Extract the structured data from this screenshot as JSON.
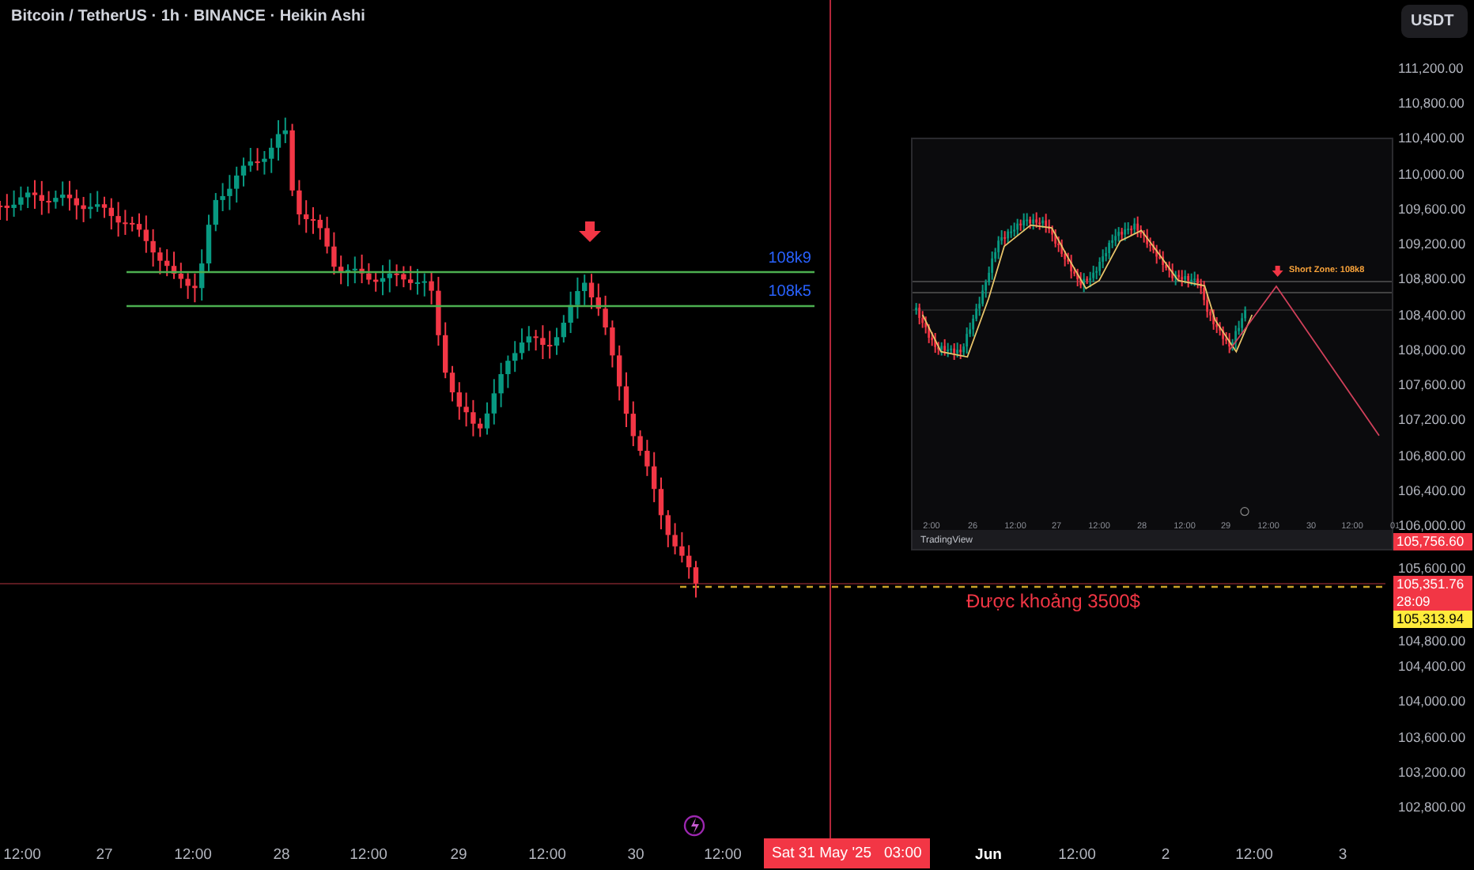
{
  "header": {
    "symbol_title": "Bitcoin / TetherUS · 1h · BINANCE · Heikin Ashi",
    "currency_button": "USDT"
  },
  "price_axis": {
    "ticks": [
      "111,200.00",
      "110,800.00",
      "110,400.00",
      "110,000.00",
      "109,600.00",
      "109,200.00",
      "108,800.00",
      "108,400.00",
      "108,000.00",
      "107,600.00",
      "107,200.00",
      "106,800.00",
      "106,400.00",
      "106,000.00",
      "105,600.00",
      "104,800.00",
      "104,400.00",
      "104,000.00",
      "103,600.00",
      "103,200.00",
      "102,800.00"
    ],
    "tags": [
      {
        "kind": "price",
        "text": "105,756.60",
        "color": "#f23645"
      },
      {
        "kind": "countdown",
        "text": "105,351.76",
        "countdown": "28:09",
        "color": "#f23645"
      },
      {
        "kind": "price",
        "text": "105,313.94",
        "color": "#ffeb3b"
      }
    ]
  },
  "levels": [
    {
      "label": "108k9"
    },
    {
      "label": "108k5"
    }
  ],
  "annotation": "Được khoảng 3500$",
  "inset": {
    "zone_label": "Short Zone: 108k8",
    "ticks": [
      "2:00",
      "26",
      "12:00",
      "27",
      "12:00",
      "28",
      "12:00",
      "29",
      "12:00",
      "30",
      "12:00",
      "01"
    ],
    "footer": "TradingView"
  },
  "time_axis": {
    "ticks": [
      {
        "kind": "time",
        "text": "12:00"
      },
      {
        "kind": "day",
        "text": "27"
      },
      {
        "kind": "time",
        "text": "12:00"
      },
      {
        "kind": "day",
        "text": "28"
      },
      {
        "kind": "time",
        "text": "12:00"
      },
      {
        "kind": "day",
        "text": "29"
      },
      {
        "kind": "time",
        "text": "12:00"
      },
      {
        "kind": "day",
        "text": "30"
      },
      {
        "kind": "time",
        "text": "12:00"
      },
      {
        "kind": "month",
        "text": "Jun"
      },
      {
        "kind": "time",
        "text": "12:00"
      },
      {
        "kind": "day",
        "text": "2"
      },
      {
        "kind": "time",
        "text": "12:00"
      },
      {
        "kind": "day",
        "text": "3"
      }
    ],
    "crosshair_label": "Sat 31 May '25   03:00"
  }
}
